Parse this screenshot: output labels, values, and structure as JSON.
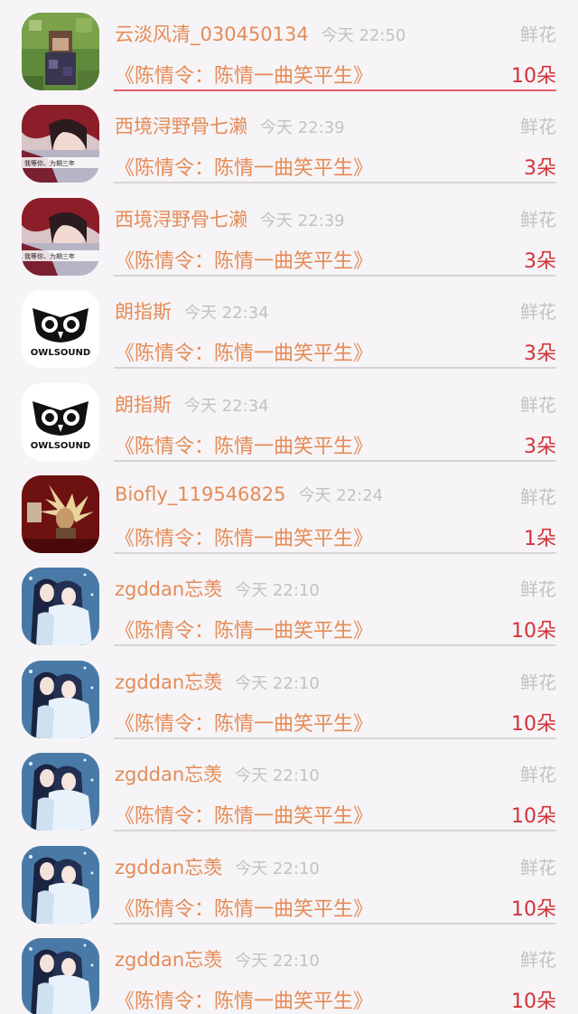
{
  "rows": [
    {
      "avatar": "photo-avatar-icon",
      "name": "云淡风清_030450134",
      "time": "今天 22:50",
      "gift": "鲜花",
      "title": "《陈情令：陈情一曲笑平生》",
      "count": "10朵"
    },
    {
      "avatar": "girl-avatar-icon",
      "name": "西境浔野骨七濑",
      "time": "今天 22:39",
      "gift": "鲜花",
      "title": "《陈情令：陈情一曲笑平生》",
      "count": "3朵"
    },
    {
      "avatar": "girl-avatar-icon",
      "name": "西境浔野骨七濑",
      "time": "今天 22:39",
      "gift": "鲜花",
      "title": "《陈情令：陈情一曲笑平生》",
      "count": "3朵"
    },
    {
      "avatar": "owlsound-logo-icon",
      "name": "朗指斯",
      "time": "今天 22:34",
      "gift": "鲜花",
      "title": "《陈情令：陈情一曲笑平生》",
      "count": "3朵"
    },
    {
      "avatar": "owlsound-logo-icon",
      "name": "朗指斯",
      "time": "今天 22:34",
      "gift": "鲜花",
      "title": "《陈情令：陈情一曲笑平生》",
      "count": "3朵"
    },
    {
      "avatar": "warrior-avatar-icon",
      "name": "Biofly_119546825",
      "time": "今天 22:24",
      "gift": "鲜花",
      "title": "《陈情令：陈情一曲笑平生》",
      "count": "1朵"
    },
    {
      "avatar": "anime-pair-avatar-icon",
      "name": "zgddan忘羡",
      "time": "今天 22:10",
      "gift": "鲜花",
      "title": "《陈情令：陈情一曲笑平生》",
      "count": "10朵"
    },
    {
      "avatar": "anime-pair-avatar-icon",
      "name": "zgddan忘羡",
      "time": "今天 22:10",
      "gift": "鲜花",
      "title": "《陈情令：陈情一曲笑平生》",
      "count": "10朵"
    },
    {
      "avatar": "anime-pair-avatar-icon",
      "name": "zgddan忘羡",
      "time": "今天 22:10",
      "gift": "鲜花",
      "title": "《陈情令：陈情一曲笑平生》",
      "count": "10朵"
    },
    {
      "avatar": "anime-pair-avatar-icon",
      "name": "zgddan忘羡",
      "time": "今天 22:10",
      "gift": "鲜花",
      "title": "《陈情令：陈情一曲笑平生》",
      "count": "10朵"
    },
    {
      "avatar": "anime-pair-avatar-icon",
      "name": "zgddan忘羡",
      "time": "今天 22:10",
      "gift": "鲜花",
      "title": "《陈情令：陈情一曲笑平生》",
      "count": "10朵"
    }
  ],
  "avatar_texts": {
    "girl_caption": "我等你、为期三年",
    "owl_brand": "OWLSOUND"
  },
  "colors": {
    "name": "#e58b57",
    "count": "#d2333a",
    "meta": "#c2c2c2",
    "background": "#f6f4f6"
  }
}
